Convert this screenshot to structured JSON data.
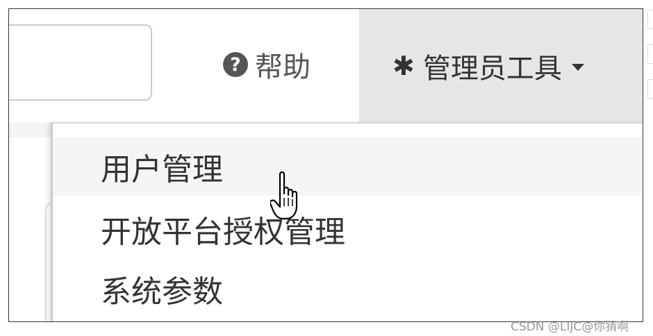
{
  "navbar": {
    "search_value": "",
    "help_label": "帮助",
    "help_icon": "question-circle-icon",
    "admin_tools_label": "管理员工具",
    "admin_tools_icon": "gear-icon",
    "admin_tools_caret": "caret-down-icon"
  },
  "dropdown": {
    "items": [
      {
        "label": "用户管理"
      },
      {
        "label": "开放平台授权管理"
      },
      {
        "label": "系统参数"
      }
    ]
  },
  "cursor": "hand-pointer-icon",
  "watermark": "CSDN @LIJC@你猜啊"
}
